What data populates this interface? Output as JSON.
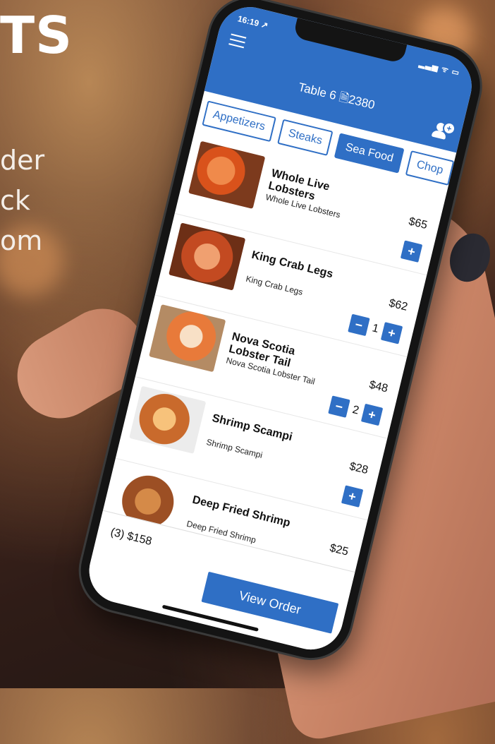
{
  "background": {
    "headline": "TS",
    "lines": [
      "der",
      "ck",
      "om"
    ]
  },
  "status_bar": {
    "time": "16:19 ↗",
    "indicators": "▂▃▅ ᯤ ▭"
  },
  "header": {
    "title": "Table 6 🗎2380"
  },
  "tabs": [
    {
      "label": "Appetizers",
      "active": false
    },
    {
      "label": "Steaks",
      "active": false
    },
    {
      "label": "Sea Food",
      "active": true
    },
    {
      "label": "Chop",
      "active": false
    }
  ],
  "items": [
    {
      "name": "Whole Live Lobsters",
      "subtitle": "Whole Live Lobsters",
      "price": "$65",
      "quantity": ""
    },
    {
      "name": "King Crab Legs",
      "subtitle": "King Crab Legs",
      "price": "$62",
      "quantity": "1"
    },
    {
      "name": "Nova Scotia Lobster Tail",
      "subtitle": "Nova Scotia Lobster Tail",
      "price": "$48",
      "quantity": "2"
    },
    {
      "name": "Shrimp Scampi",
      "subtitle": "Shrimp Scampi",
      "price": "$28",
      "quantity": ""
    },
    {
      "name": "Deep Fried Shrimp",
      "subtitle": "Deep Fried Shrimp",
      "price": "$25",
      "quantity": ""
    }
  ],
  "footer": {
    "summary": "(3) $158",
    "view_order_label": "View Order"
  },
  "controls": {
    "minus": "−",
    "plus": "+"
  },
  "colors": {
    "accent": "#2f6fc5"
  }
}
